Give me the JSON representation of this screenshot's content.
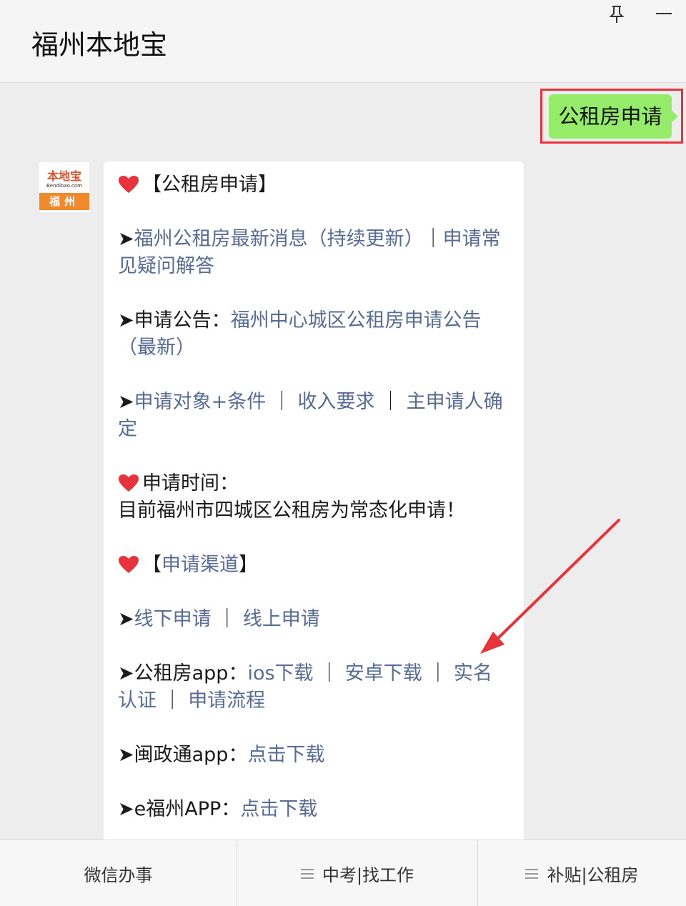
{
  "window": {
    "title": "福州本地宝"
  },
  "user_message": {
    "text": "公租房申请"
  },
  "avatar": {
    "brand": "本地宝",
    "sub": "Bendibao.com",
    "city": "福州"
  },
  "reply": {
    "p1": {
      "heading": "【公租房申请】"
    },
    "p2": {
      "arrow": "➤",
      "link1": "福州公租房最新消息（持续更新）",
      "sep": "｜",
      "link2": "申请常见疑问解答"
    },
    "p3": {
      "arrow": "➤",
      "label": "申请公告：",
      "link1": "福州中心城区公租房申请公告（最新）"
    },
    "p4": {
      "arrow": "➤",
      "link1": "申请对象+条件",
      "sep1": "｜",
      "link2": "收入要求",
      "sep2": "｜",
      "link3": "主申请人确定"
    },
    "p5": {
      "label": "申请时间：",
      "line2": "目前福州市四城区公租房为常态化申请！"
    },
    "p6": {
      "open": "【",
      "link1": "申请渠道",
      "close": "】"
    },
    "p7": {
      "arrow": "➤",
      "link1": "线下申请",
      "sep": "｜",
      "link2": "线上申请"
    },
    "p8": {
      "arrow": "➤",
      "label": "公租房app：",
      "link1": "ios下载",
      "sep1": "｜",
      "link2": "安卓下载",
      "sep2": "｜",
      "link3": "实名认证",
      "sep3": "｜",
      "link4": "申请流程"
    },
    "p9": {
      "arrow": "➤",
      "label": "闽政通app：",
      "link1": "点击下载"
    },
    "p10": {
      "arrow": "➤",
      "label": "e福州APP：",
      "link1": "点击下载"
    }
  },
  "bottom_menu": {
    "items": [
      {
        "label": "微信办事",
        "has_icon": false
      },
      {
        "label": "中考|找工作",
        "has_icon": true
      },
      {
        "label": "补贴|公租房",
        "has_icon": true
      }
    ]
  },
  "colors": {
    "link": "#576b95",
    "user_bubble": "#95ec69",
    "highlight_box": "#e8323c",
    "heart": "#e8323c"
  }
}
